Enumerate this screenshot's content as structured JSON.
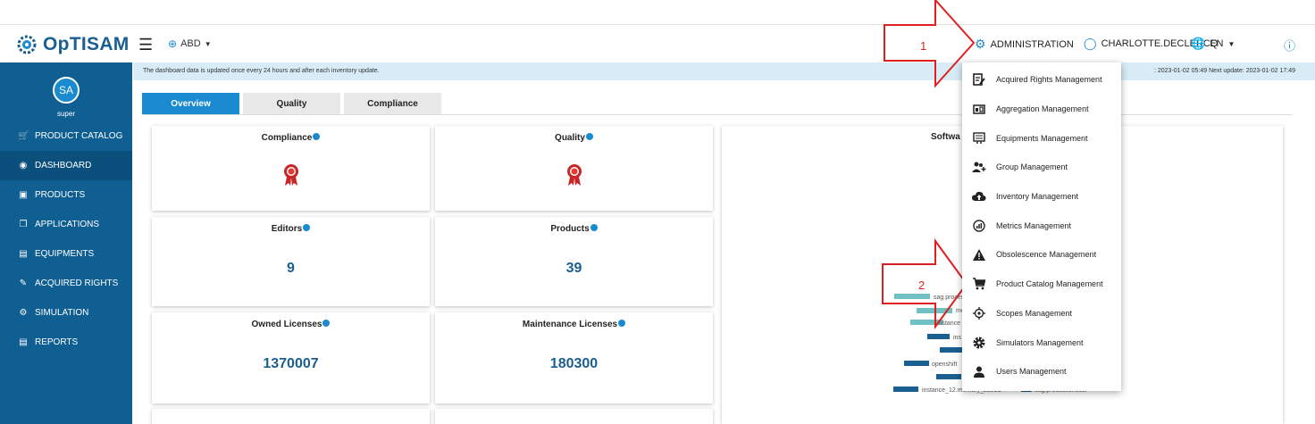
{
  "header": {
    "app_name": "OpTISAM",
    "scope": "ABD",
    "administration": "ADMINISTRATION",
    "user": "CHARLOTTE.DECLERCQ",
    "language": "EN"
  },
  "sidebar": {
    "avatar_initials": "SA",
    "username": "super",
    "items": [
      {
        "label": "PRODUCT CATALOG"
      },
      {
        "label": "DASHBOARD"
      },
      {
        "label": "PRODUCTS"
      },
      {
        "label": "APPLICATIONS"
      },
      {
        "label": "EQUIPMENTS"
      },
      {
        "label": "ACQUIRED RIGHTS"
      },
      {
        "label": "SIMULATION"
      },
      {
        "label": "REPORTS"
      }
    ]
  },
  "info_bar": {
    "message": "The dashboard data is updated once every 24 hours and after each inventory update.",
    "right": ": 2023-01-02 05:49   Next update: 2023-01-02 17:49"
  },
  "tabs": [
    "Overview",
    "Quality",
    "Compliance"
  ],
  "cards": {
    "compliance": "Compliance",
    "quality": "Quality",
    "editors_title": "Editors",
    "editors_value": "9",
    "products_title": "Products",
    "products_value": "39",
    "owned_title": "Owned Licenses",
    "owned_value": "1370007",
    "maintenance_title": "Maintenance Licenses",
    "maintenance_value": "180300"
  },
  "chart": {
    "title": "Softwa",
    "labels": [
      "sag.process",
      "memo",
      "instance",
      "ins",
      "openshift",
      "instance_12.memory_2301D",
      "sag.processor.user"
    ]
  },
  "admin_menu": {
    "items": [
      {
        "label": "Acquired Rights Management",
        "icon": "edit-doc-icon"
      },
      {
        "label": "Aggregation Management",
        "icon": "aggregation-icon"
      },
      {
        "label": "Equipments Management",
        "icon": "server-icon"
      },
      {
        "label": "Group Management",
        "icon": "group-add-icon"
      },
      {
        "label": "Inventory Management",
        "icon": "cloud-upload-icon"
      },
      {
        "label": "Metrics Management",
        "icon": "metrics-icon"
      },
      {
        "label": "Obsolescence Management",
        "icon": "warning-icon"
      },
      {
        "label": "Product Catalog Management",
        "icon": "cart-icon"
      },
      {
        "label": "Scopes Management",
        "icon": "target-icon"
      },
      {
        "label": "Simulators Management",
        "icon": "gear-icon"
      },
      {
        "label": "Users Management",
        "icon": "user-icon"
      }
    ]
  },
  "annotations": {
    "one": "1",
    "two": "2"
  },
  "colors": {
    "brand": "#0f5f93",
    "accent": "#1a8ad1",
    "arrow": "#e02020",
    "bar_light": "#6fc1c4",
    "bar_dark": "#1a5f8f"
  }
}
